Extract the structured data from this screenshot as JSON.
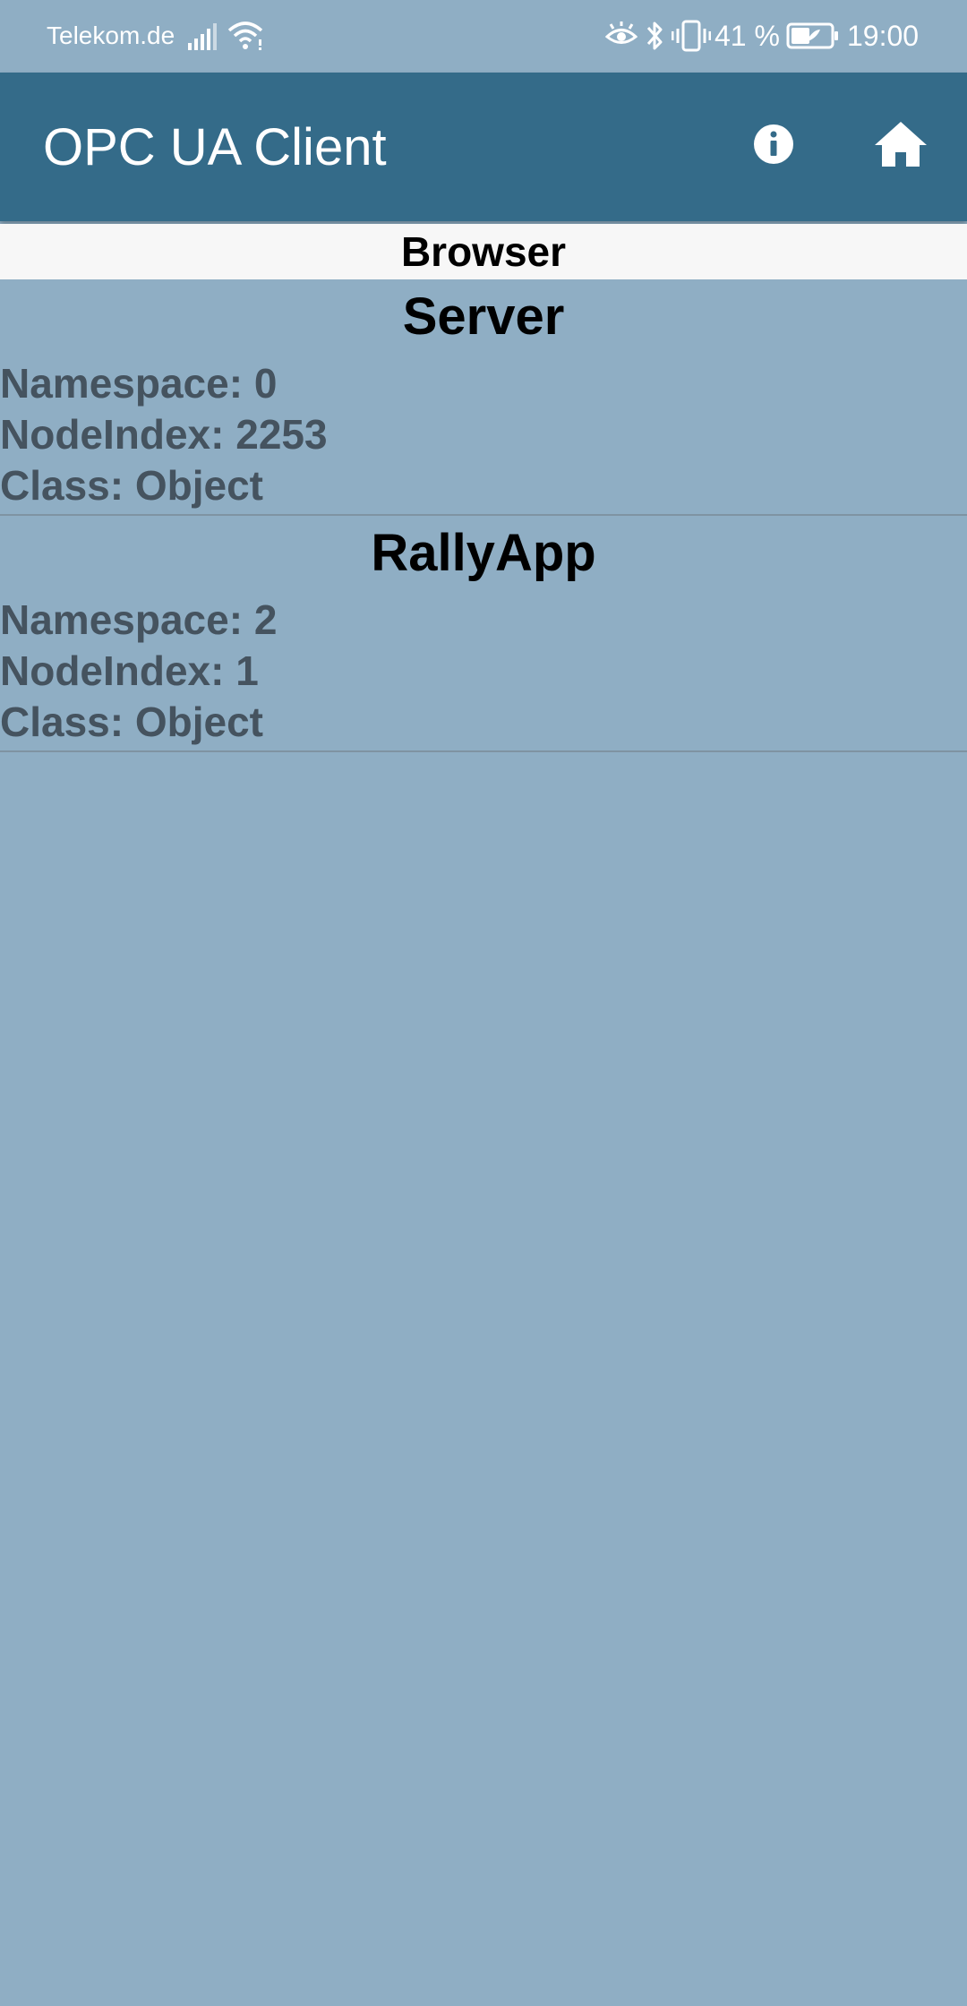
{
  "status_bar": {
    "carrier": "Telekom.de",
    "battery_percent": "41 %",
    "time": "19:00",
    "icons": [
      "signal-icon",
      "wifi-icon",
      "eye-comfort-icon",
      "bluetooth-icon",
      "vibrate-icon",
      "battery-icon"
    ]
  },
  "app_bar": {
    "title": "OPC UA Client",
    "actions": [
      "info-icon",
      "home-icon"
    ]
  },
  "browser": {
    "title": "Browser"
  },
  "nodes": [
    {
      "name": "Server",
      "namespace": "Namespace: 0",
      "node_index": "NodeIndex: 2253",
      "class": "Class: Object"
    },
    {
      "name": "RallyApp",
      "namespace": "Namespace: 2",
      "node_index": "NodeIndex: 1",
      "class": "Class: Object"
    }
  ],
  "colors": {
    "background": "#8faec4",
    "app_bar": "#346b89",
    "sub_header": "#f7f7f7",
    "secondary_text": "#45535f"
  }
}
